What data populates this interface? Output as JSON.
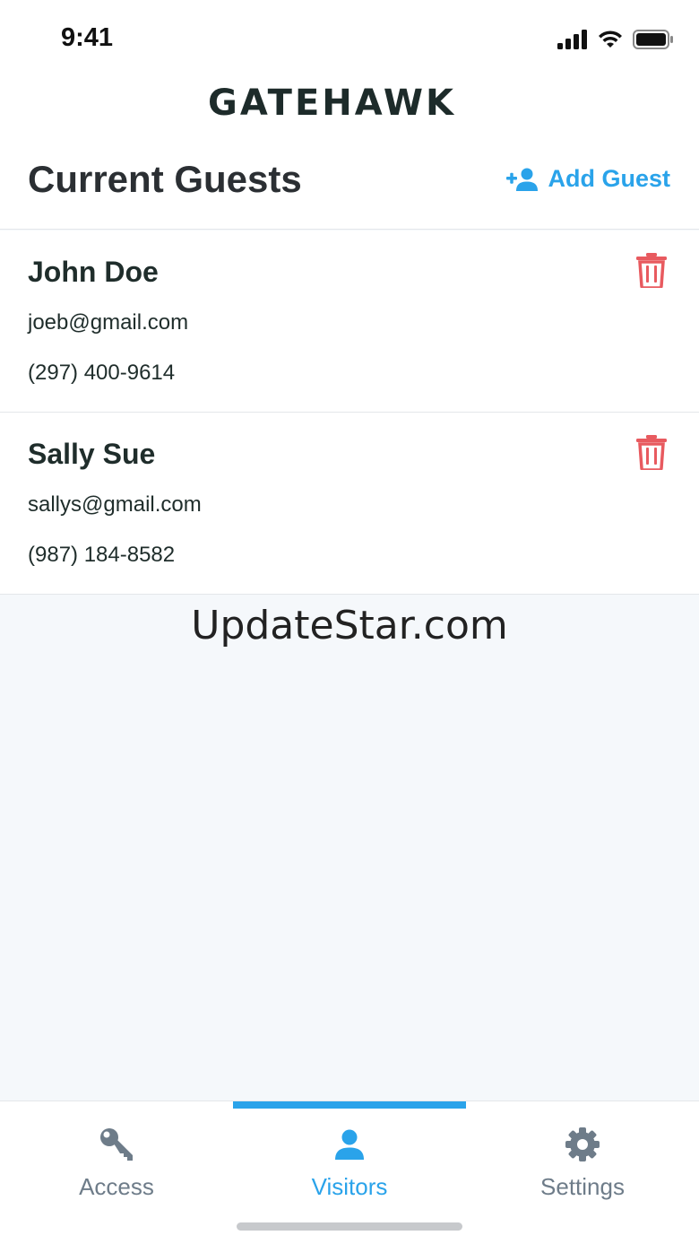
{
  "status_bar": {
    "time": "9:41"
  },
  "app": {
    "brand": "GATEHAWK"
  },
  "header": {
    "title": "Current Guests",
    "add_label": "Add Guest"
  },
  "guests": [
    {
      "name": "John Doe",
      "email": "joeb@gmail.com",
      "phone": "(297) 400-9614"
    },
    {
      "name": "Sally Sue",
      "email": "sallys@gmail.com",
      "phone": "(987) 184-8582"
    }
  ],
  "watermark": "UpdateStar.com",
  "tabs": [
    {
      "label": "Access",
      "icon": "key-icon"
    },
    {
      "label": "Visitors",
      "icon": "person-icon",
      "active": true
    },
    {
      "label": "Settings",
      "icon": "gear-icon"
    }
  ],
  "colors": {
    "accent": "#2aa3ea",
    "delete": "#e85a5f",
    "inactive": "#6e7c89"
  }
}
